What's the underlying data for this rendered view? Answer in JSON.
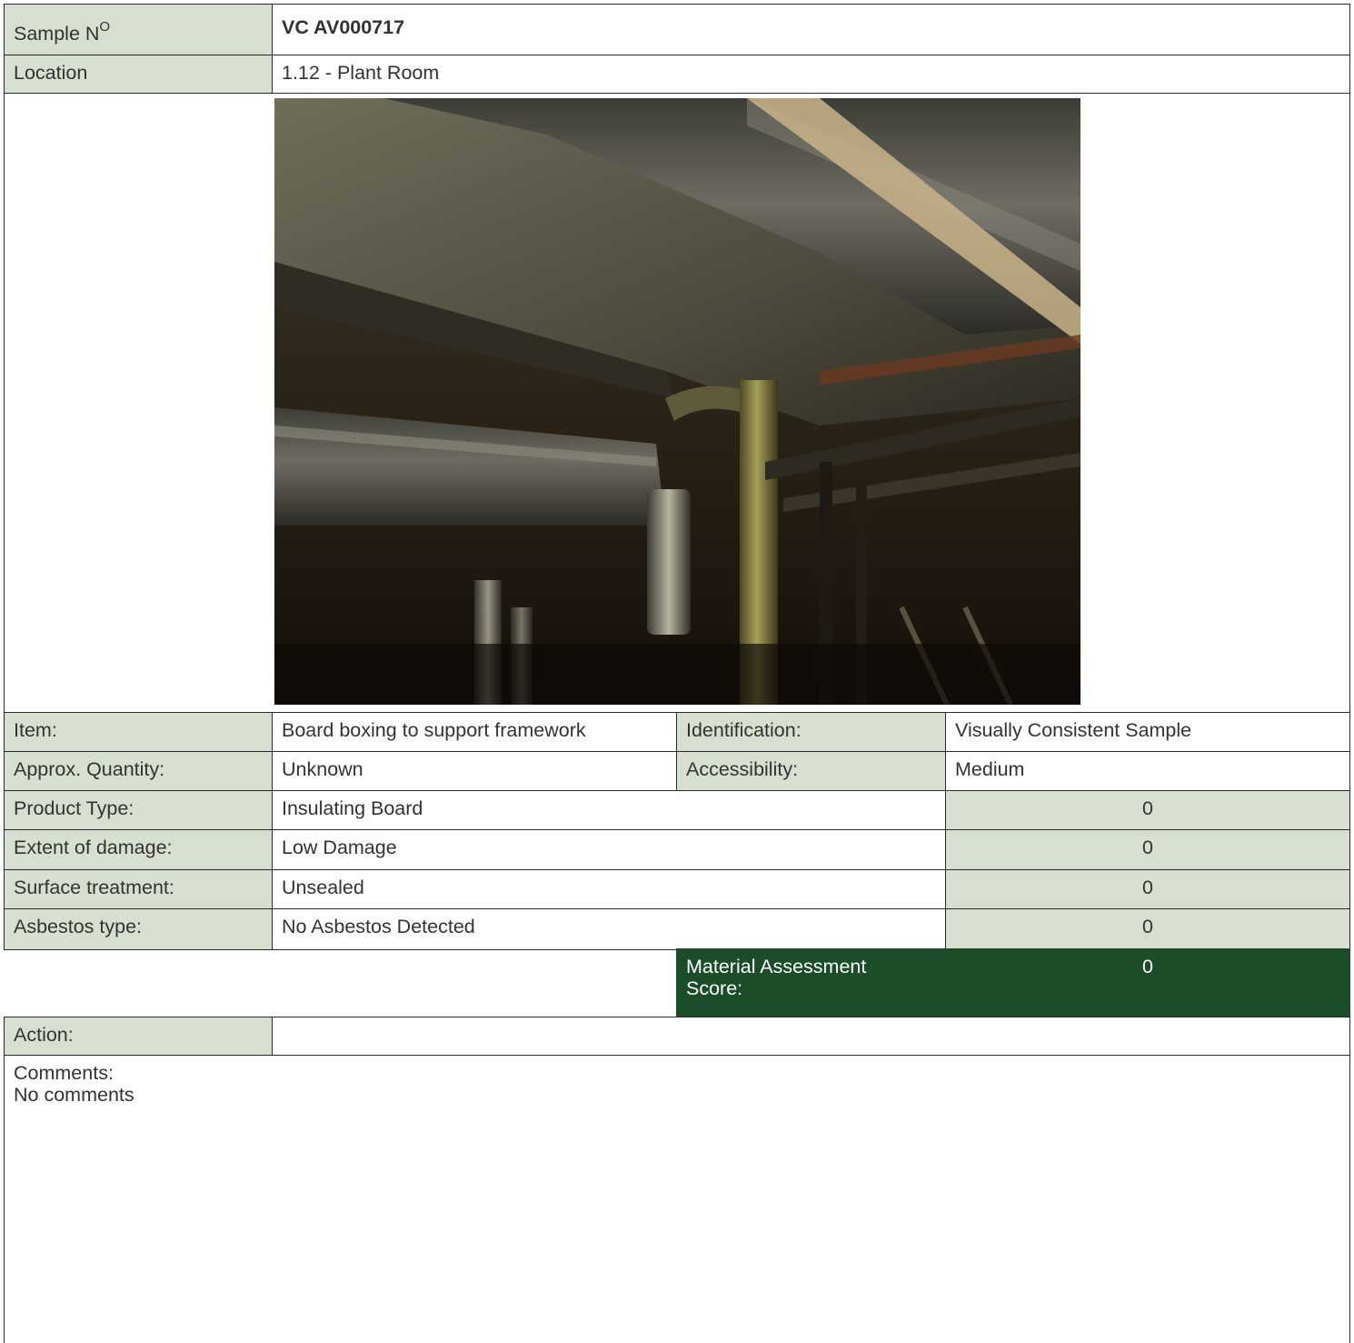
{
  "header": {
    "sample_label": "Sample N",
    "sample_sup": "O",
    "sample_value": "VC AV000717",
    "location_label": "Location",
    "location_value": "1.12 - Plant Room"
  },
  "photo": {
    "icon": "sample-photo",
    "description_hidden": ""
  },
  "details": {
    "item_label": "Item:",
    "item_value": "Board boxing to support framework",
    "identification_label": "Identification:",
    "identification_value": "Visually Consistent Sample",
    "quantity_label": "Approx. Quantity:",
    "quantity_value": "Unknown",
    "accessibility_label": "Accessibility:",
    "accessibility_value": "Medium"
  },
  "assessment": [
    {
      "label": "Product Type:",
      "value": "Insulating Board",
      "score": "0"
    },
    {
      "label": "Extent of damage:",
      "value": "Low Damage",
      "score": "0"
    },
    {
      "label": "Surface treatment:",
      "value": "Unsealed",
      "score": "0"
    },
    {
      "label": "Asbestos type:",
      "value": "No Asbestos Detected",
      "score": "0"
    }
  ],
  "total": {
    "label": "Material Assessment Score:",
    "score": "0"
  },
  "action": {
    "label": "Action:",
    "value": ""
  },
  "comments": {
    "label": "Comments:",
    "value": "No comments"
  },
  "colors": {
    "label_bg": "#d6dfd0",
    "score_total_bg": "#1b4d28",
    "border": "#2a2a2a"
  }
}
